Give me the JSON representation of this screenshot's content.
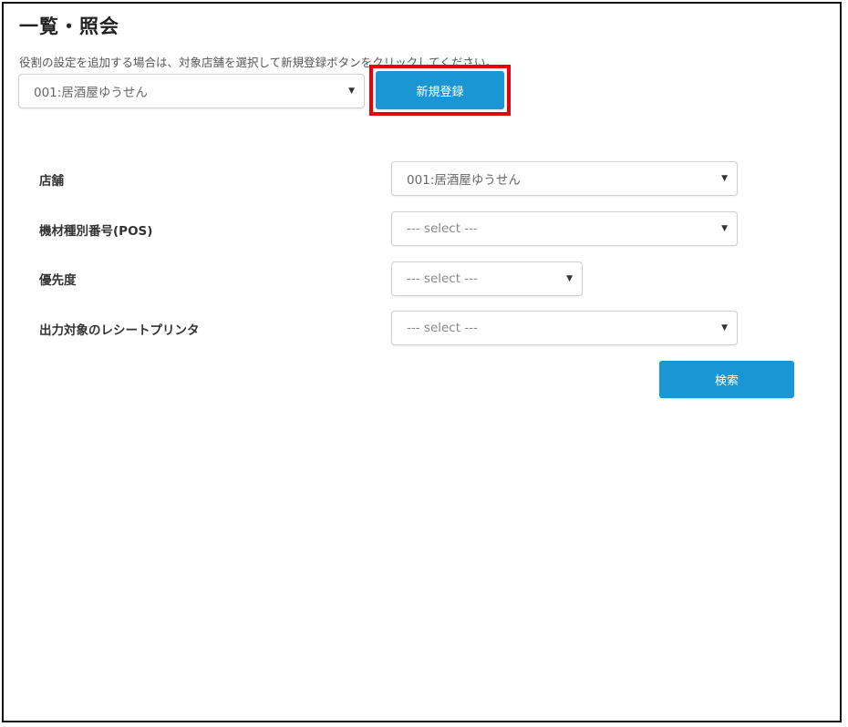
{
  "page": {
    "title": "一覧・照会",
    "instruction": "役割の設定を追加する場合は、対象店舗を選択して新規登録ボタンをクリックしてください。"
  },
  "top_bar": {
    "store_select_value": "001:居酒屋ゆうせん",
    "new_button_label": "新規登録",
    "highlight_color": "#e8000b"
  },
  "search_form": {
    "fields": [
      {
        "label": "店舗",
        "value": "001:居酒屋ゆうせん"
      },
      {
        "label": "機材種別番号(POS)",
        "value": "--- select ---"
      },
      {
        "label": "優先度",
        "value": "--- select ---"
      },
      {
        "label": "出力対象のレシートプリンタ",
        "value": "--- select ---"
      }
    ],
    "search_button_label": "検索"
  },
  "theme": {
    "accent": "#1a96d4",
    "border": "#cfcfcf"
  },
  "icons": {
    "caret": "▼"
  }
}
